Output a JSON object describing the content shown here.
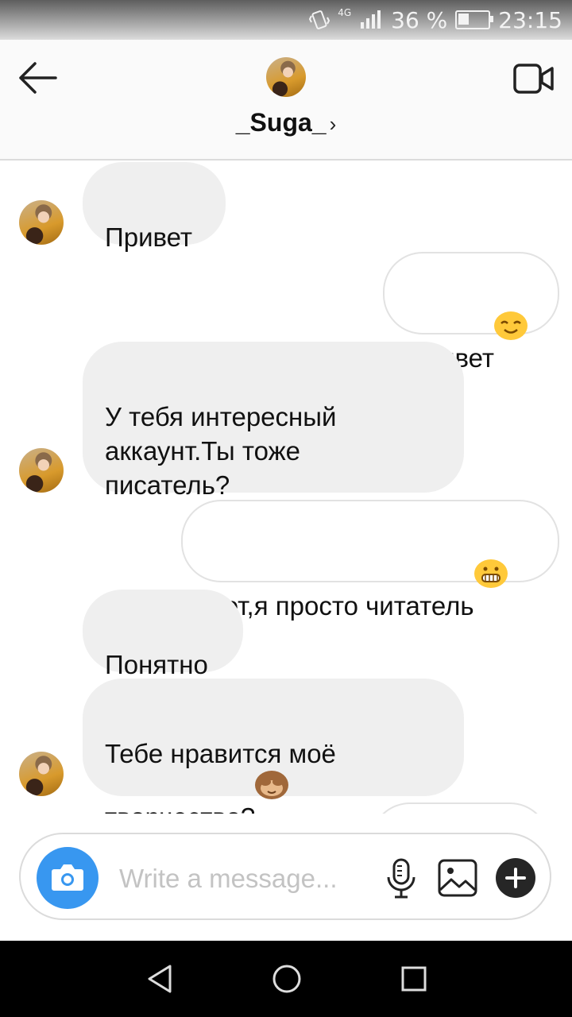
{
  "status": {
    "network": "4G",
    "battery_text": "36 %",
    "battery_level": 0.36,
    "time": "23:15"
  },
  "header": {
    "username": "_Suga_",
    "chevron": "›",
    "back_icon": "arrow-left-icon",
    "video_icon": "video-camera-icon"
  },
  "messages": [
    {
      "side": "in",
      "text": "Привет",
      "emoji": null
    },
    {
      "side": "out",
      "text": "Привет",
      "emoji": "smiling-face-emoji"
    },
    {
      "side": "in",
      "text": "У тебя интересный\nаккаунт.Ты тоже\nписатель?",
      "emoji": null
    },
    {
      "side": "out",
      "text": "Нет,я просто читатель",
      "emoji": "grinning-face-emoji"
    },
    {
      "side": "in",
      "text": "Понятно",
      "emoji": null
    },
    {
      "side": "in",
      "text": "Тебе нравится моё\nтворчество?",
      "emoji": "see-no-evil-monkey-emoji"
    }
  ],
  "composer": {
    "placeholder": "Write a message...",
    "icons": [
      "camera-icon",
      "microphone-icon",
      "gallery-icon",
      "plus-icon"
    ],
    "camera_color": "#3897f0"
  },
  "nav": {
    "icons": [
      "back-triangle-icon",
      "home-circle-icon",
      "recents-square-icon"
    ]
  }
}
